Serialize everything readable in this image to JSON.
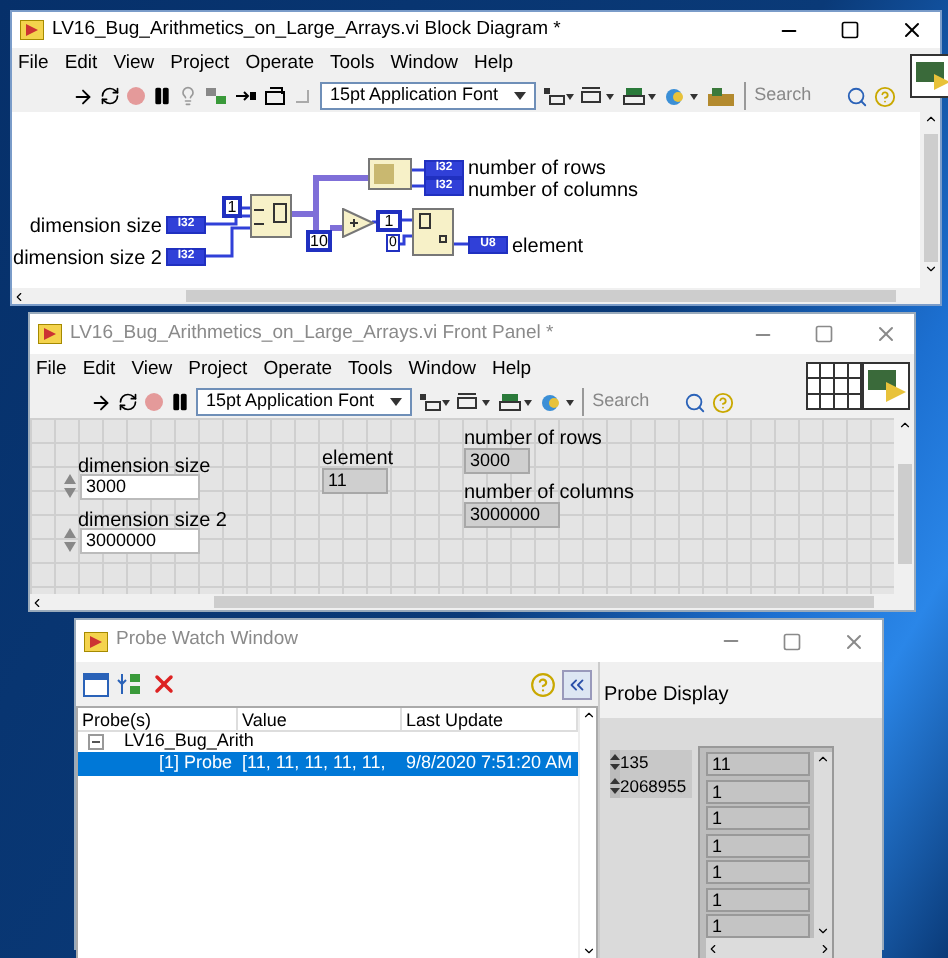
{
  "block_diagram": {
    "title": "LV16_Bug_Arithmetics_on_Large_Arrays.vi Block Diagram *",
    "active": true,
    "menu": [
      "File",
      "Edit",
      "View",
      "Project",
      "Operate",
      "Tools",
      "Window",
      "Help"
    ],
    "font_selector": "15pt Application Font",
    "search": {
      "placeholder": "Search"
    },
    "controls": [
      {
        "label": "dimension size",
        "type": "I32"
      },
      {
        "label": "dimension size 2",
        "type": "I32"
      }
    ],
    "constants": [
      "1",
      "10",
      "1",
      "0"
    ],
    "indicators": [
      {
        "label": "number of rows",
        "type": "I32"
      },
      {
        "label": "number of columns",
        "type": "I32"
      },
      {
        "label": "element",
        "type": "U8"
      }
    ]
  },
  "front_panel": {
    "title": "LV16_Bug_Arithmetics_on_Large_Arrays.vi Front Panel *",
    "active": false,
    "menu": [
      "File",
      "Edit",
      "View",
      "Project",
      "Operate",
      "Tools",
      "Window",
      "Help"
    ],
    "font_selector": "15pt Application Font",
    "search": {
      "placeholder": "Search"
    },
    "controls": [
      {
        "label": "dimension size",
        "value": "3000"
      },
      {
        "label": "dimension size 2",
        "value": "3000000"
      }
    ],
    "indicators": [
      {
        "label": "element",
        "value": "11"
      },
      {
        "label": "number of rows",
        "value": "3000"
      },
      {
        "label": "number of columns",
        "value": "3000000"
      }
    ]
  },
  "probe_watch": {
    "title": "Probe Watch Window",
    "active": false,
    "columns": [
      "Probe(s)",
      "Value",
      "Last Update"
    ],
    "tree": [
      {
        "label": "LV16_Bug_Arith",
        "expanded": true,
        "children": [
          {
            "probe": "[1] Probe",
            "value": "[11, 11, 11, 11, 11,",
            "last_update": "9/8/2020 7:51:20 AM",
            "selected": true
          }
        ]
      }
    ],
    "probe_display": {
      "title": "Probe Display",
      "indices": [
        "135",
        "2068955"
      ],
      "elements": [
        "11",
        "1",
        "1",
        "1",
        "1",
        "1",
        "1"
      ]
    }
  }
}
